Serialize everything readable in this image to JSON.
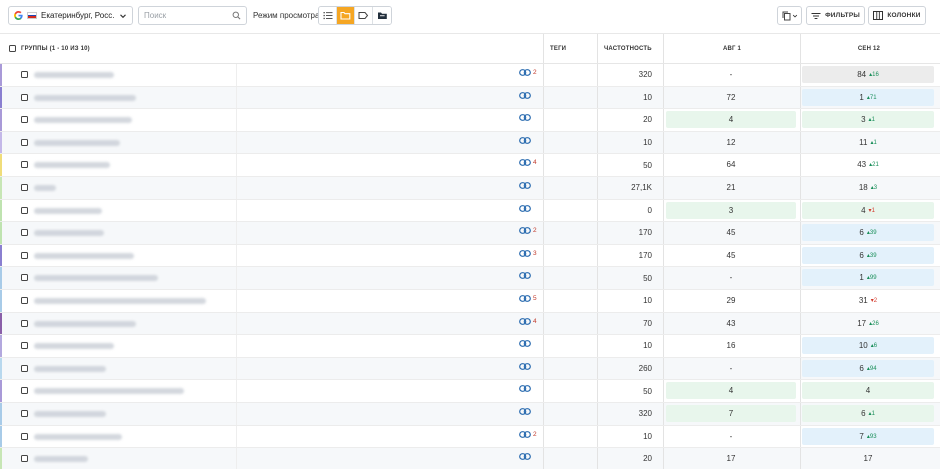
{
  "toolbar": {
    "region": "Екатеринбург, Росс...",
    "search_placeholder": "Поиск",
    "view_mode_label": "Режим просмотра:",
    "filters_label": "ФИЛЬТРЫ",
    "columns_label": "КОЛОНКИ"
  },
  "table": {
    "headers": {
      "groups": "ГРУППЫ (1 - 10 ИЗ 10)",
      "tags": "ТЕГИ",
      "frequency": "ЧАСТОТНОСТЬ",
      "aug": "АВГ 1",
      "sep": "СЕН 12"
    },
    "rows": [
      {
        "bar": "#a99ad8",
        "links": "2",
        "freq": "320",
        "aug": "-",
        "aug_bg": "",
        "sep": "84",
        "sep_delta": "16",
        "sep_dir": "up",
        "sep_bg": "grey",
        "name_w": 80
      },
      {
        "bar": "#8a7fd0",
        "links": "",
        "freq": "10",
        "aug": "72",
        "aug_bg": "",
        "sep": "1",
        "sep_delta": "71",
        "sep_dir": "up",
        "sep_bg": "blue",
        "name_w": 102
      },
      {
        "bar": "#a99ad8",
        "links": "",
        "freq": "20",
        "aug": "4",
        "aug_bg": "green",
        "sep": "3",
        "sep_delta": "1",
        "sep_dir": "up",
        "sep_bg": "green",
        "name_w": 98
      },
      {
        "bar": "#c4b8e8",
        "links": "",
        "freq": "10",
        "aug": "12",
        "aug_bg": "",
        "sep": "11",
        "sep_delta": "1",
        "sep_dir": "up",
        "sep_bg": "",
        "name_w": 86
      },
      {
        "bar": "#f0dd7a",
        "links": "4",
        "freq": "50",
        "aug": "64",
        "aug_bg": "",
        "sep": "43",
        "sep_delta": "21",
        "sep_dir": "up",
        "sep_bg": "",
        "name_w": 76
      },
      {
        "bar": "#c7e6b5",
        "links": "",
        "freq": "27,1K",
        "aug": "21",
        "aug_bg": "",
        "sep": "18",
        "sep_delta": "3",
        "sep_dir": "up",
        "sep_bg": "",
        "name_w": 22
      },
      {
        "bar": "#bfe3b0",
        "links": "",
        "freq": "0",
        "aug": "3",
        "aug_bg": "green",
        "sep": "4",
        "sep_delta": "1",
        "sep_dir": "down",
        "sep_bg": "green",
        "name_w": 68
      },
      {
        "bar": "#bfe3b0",
        "links": "2",
        "freq": "170",
        "aug": "45",
        "aug_bg": "",
        "sep": "6",
        "sep_delta": "39",
        "sep_dir": "up",
        "sep_bg": "blue",
        "name_w": 70
      },
      {
        "bar": "#8a7fd0",
        "links": "3",
        "freq": "170",
        "aug": "45",
        "aug_bg": "",
        "sep": "6",
        "sep_delta": "39",
        "sep_dir": "up",
        "sep_bg": "blue",
        "name_w": 100
      },
      {
        "bar": "#a8cbe8",
        "links": "",
        "freq": "50",
        "aug": "-",
        "aug_bg": "",
        "sep": "1",
        "sep_delta": "99",
        "sep_dir": "up",
        "sep_bg": "blue",
        "name_w": 124
      },
      {
        "bar": "#a8cbe8",
        "links": "5",
        "freq": "10",
        "aug": "29",
        "aug_bg": "",
        "sep": "31",
        "sep_delta": "2",
        "sep_dir": "down",
        "sep_bg": "",
        "name_w": 172
      },
      {
        "bar": "#8a5fa8",
        "links": "4",
        "freq": "70",
        "aug": "43",
        "aug_bg": "",
        "sep": "17",
        "sep_delta": "26",
        "sep_dir": "up",
        "sep_bg": "",
        "name_w": 102
      },
      {
        "bar": "#b3a8de",
        "links": "",
        "freq": "10",
        "aug": "16",
        "aug_bg": "",
        "sep": "10",
        "sep_delta": "6",
        "sep_dir": "up",
        "sep_bg": "blue",
        "name_w": 80
      },
      {
        "bar": "#b8d8ee",
        "links": "",
        "freq": "260",
        "aug": "-",
        "aug_bg": "",
        "sep": "6",
        "sep_delta": "94",
        "sep_dir": "up",
        "sep_bg": "blue",
        "name_w": 72
      },
      {
        "bar": "#a99ad8",
        "links": "",
        "freq": "50",
        "aug": "4",
        "aug_bg": "green",
        "sep": "4",
        "sep_delta": "",
        "sep_dir": "",
        "sep_bg": "green",
        "name_w": 150
      },
      {
        "bar": "#a8cbe8",
        "links": "",
        "freq": "320",
        "aug": "7",
        "aug_bg": "green",
        "sep": "6",
        "sep_delta": "1",
        "sep_dir": "up",
        "sep_bg": "green",
        "name_w": 72
      },
      {
        "bar": "#a8cbe8",
        "links": "2",
        "freq": "10",
        "aug": "-",
        "aug_bg": "",
        "sep": "7",
        "sep_delta": "93",
        "sep_dir": "up",
        "sep_bg": "blue",
        "name_w": 88
      },
      {
        "bar": "#c7e6b5",
        "links": "",
        "freq": "20",
        "aug": "17",
        "aug_bg": "",
        "sep": "17",
        "sep_delta": "",
        "sep_dir": "",
        "sep_bg": "",
        "name_w": 54
      }
    ]
  },
  "colors": {
    "accent": "#f5a623",
    "green_cell": "#e8f6ec",
    "blue_cell": "#e3f1fb",
    "grey_cell": "#ececec",
    "link": "#2b6cb0",
    "delta_up": "#1a8f5a",
    "delta_down": "#d33a2c"
  },
  "icons": {
    "search": "search-icon",
    "list_view": "list-view-icon",
    "folder_view": "folder-view-icon",
    "tag_view": "tag-view-icon",
    "folder_dark": "folder-dark-icon",
    "copy": "copy-icon",
    "filter": "filter-icon",
    "columns": "columns-icon",
    "link": "link-icon"
  }
}
